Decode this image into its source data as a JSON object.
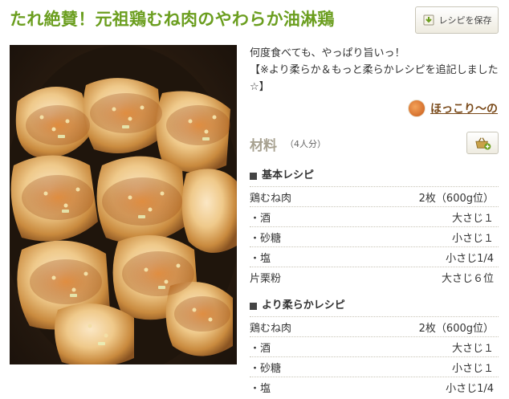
{
  "recipe": {
    "title": "たれ絶賛！元祖鶏むね肉のやわらか油淋鶏",
    "save_label": "レシピを保存",
    "description": [
      "何度食べても、やっぱり旨いっ！",
      "【※より柔らか＆もっと柔らかレシピを追記しました☆】"
    ],
    "author": "ほっこり〜の"
  },
  "ingredients": {
    "heading": "材料",
    "serves": "（4人分）",
    "groups": [
      {
        "label": "基本レシピ",
        "items": [
          {
            "name": "鶏むね肉",
            "amount": "2枚（600g位）"
          },
          {
            "name": "・酒",
            "amount": "大さじ１"
          },
          {
            "name": "・砂糖",
            "amount": "小さじ１"
          },
          {
            "name": "・塩",
            "amount": "小さじ1/4"
          },
          {
            "name": "片栗粉",
            "amount": "大さじ６位"
          }
        ]
      },
      {
        "label": "より柔らかレシピ",
        "items": [
          {
            "name": "鶏むね肉",
            "amount": "2枚（600g位）"
          },
          {
            "name": "・酒",
            "amount": "大さじ１"
          },
          {
            "name": "・砂糖",
            "amount": "小さじ１"
          },
          {
            "name": "・塩",
            "amount": "小さじ1/4"
          }
        ]
      }
    ]
  },
  "colors": {
    "title": "#6b9e1f",
    "author": "#7a4a1a",
    "ingredient_heading": "#a8a291"
  },
  "icons": {
    "save": "recipe-save-icon",
    "basket": "shopping-basket-icon",
    "avatar": "author-avatar"
  }
}
